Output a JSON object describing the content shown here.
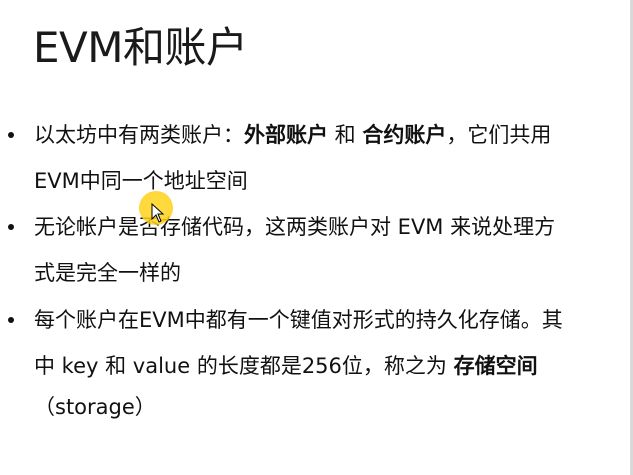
{
  "slide": {
    "title": "EVM和账户",
    "bullet1": {
      "line1_a": "以太坊中有两类账户：",
      "line1_b": "外部账户",
      "line1_c": " 和 ",
      "line1_d": "合约账户",
      "line1_e": "，它们共用",
      "line2": "EVM中同一个地址空间"
    },
    "bullet2": {
      "line1": "无论帐户是否存储代码，这两类账户对 EVM 来说处理方",
      "line2": "式是完全一样的"
    },
    "bullet3": {
      "line1": "每个账户在EVM中都有一个键值对形式的持久化存储。其",
      "line2_a": "中 key 和 value 的长度都是256位，称之为 ",
      "line2_b": "存储空间",
      "line3": "（storage）"
    }
  },
  "colors": {
    "background": "#ffffff",
    "text": "#111111",
    "cursor_highlight": "#ffd51a"
  },
  "icons": {
    "cursor": "mouse-cursor-highlight-icon"
  }
}
